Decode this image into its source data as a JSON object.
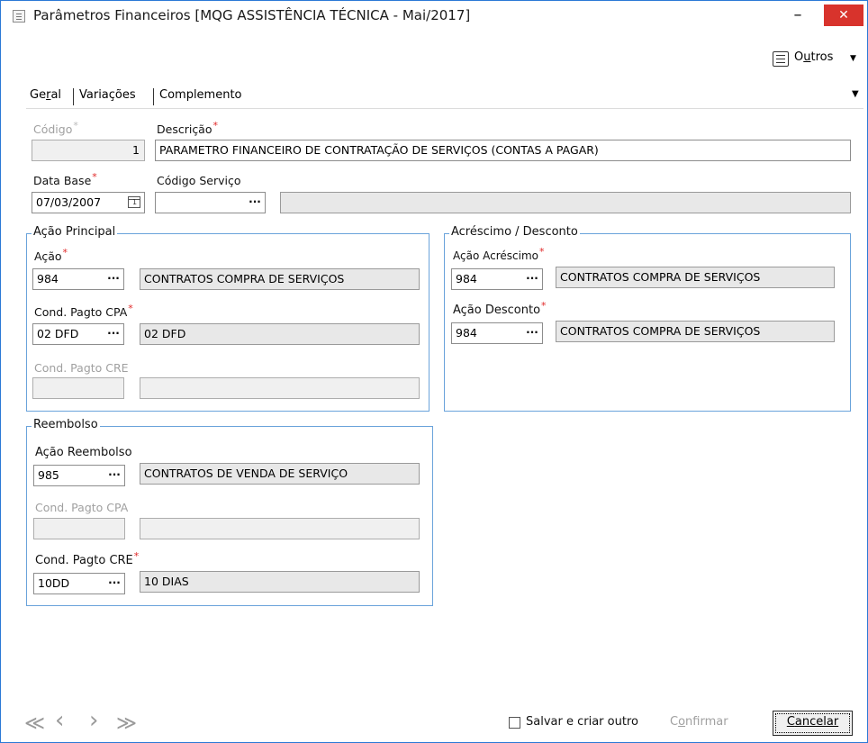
{
  "window": {
    "title": "Parâmetros Financeiros [MQG ASSISTÊNCIA TÉCNICA - Mai/2017]",
    "minimize_glyph": "–",
    "close_glyph": "✕"
  },
  "toolbar": {
    "outros_prefix": "O",
    "outros_underlined": "u",
    "outros_rest": "tros",
    "outros_caret": "▼"
  },
  "tabs": {
    "geral_a": "Ge",
    "geral_u": "r",
    "geral_b": "al",
    "variacoes": "Variações",
    "complemento": "Complemento",
    "caret": "▼"
  },
  "form": {
    "codigo_label": "Código",
    "codigo_value": "1",
    "descricao_label": "Descrição",
    "descricao_value": "PARAMETRO FINANCEIRO DE CONTRATAÇÃO DE SERVIÇOS (CONTAS A PAGAR)",
    "data_base_label": "Data Base",
    "data_base_value": "07/03/2007",
    "codigo_servico_label": "Código Serviço",
    "codigo_servico_value": "",
    "codigo_servico_desc": "",
    "required_mark": "*",
    "lookup_glyph": "···"
  },
  "acao_principal": {
    "title": "Ação Principal",
    "acao_label": "Ação",
    "acao_code": "984",
    "acao_desc": "CONTRATOS COMPRA DE SERVIÇOS",
    "cpa_label": "Cond. Pagto CPA",
    "cpa_code": "02 DFD",
    "cpa_desc": "02 DFD",
    "cre_label": "Cond. Pagto CRE",
    "cre_code": "",
    "cre_desc": ""
  },
  "acrescimo_desconto": {
    "title": "Acréscimo / Desconto",
    "acrescimo_label": "Ação Acréscimo",
    "acrescimo_code": "984",
    "acrescimo_desc": "CONTRATOS COMPRA DE SERVIÇOS",
    "desconto_label": "Ação Desconto",
    "desconto_code": "984",
    "desconto_desc": "CONTRATOS COMPRA DE SERVIÇOS"
  },
  "reembolso": {
    "title": "Reembolso",
    "acao_label": "Ação Reembolso",
    "acao_code": "985",
    "acao_desc": "CONTRATOS DE VENDA DE SERVIÇO",
    "cpa_label": "Cond. Pagto CPA",
    "cpa_code": "",
    "cpa_desc": "",
    "cre_label": "Cond. Pagto CRE",
    "cre_code": "10DD",
    "cre_desc": "10 DIAS"
  },
  "footer": {
    "first": "≪",
    "prev": "‹",
    "next": "›",
    "last": "≫",
    "salvar_label": "Salvar e criar outro",
    "confirmar_a": "C",
    "confirmar_u": "o",
    "confirmar_b": "nfirmar",
    "cancelar_u": "C",
    "cancelar_b": "ancelar"
  },
  "colors": {
    "group_border": "#6aa3db",
    "required": "#e02828",
    "close_button": "#d8332c"
  }
}
